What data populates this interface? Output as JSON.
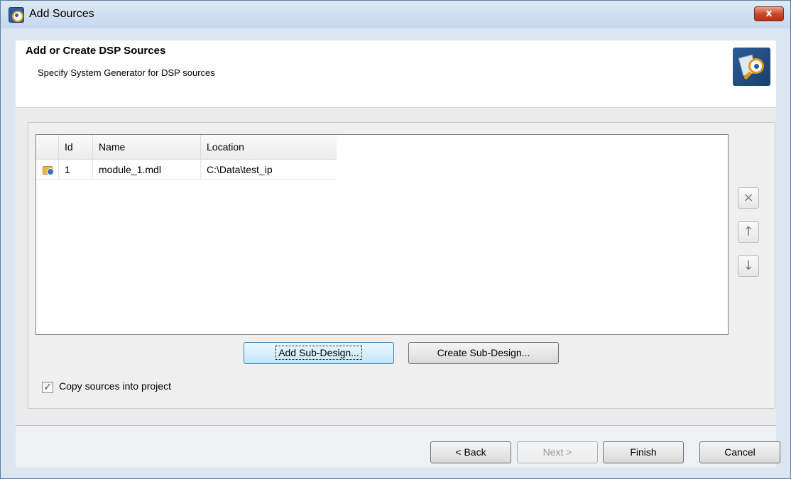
{
  "window": {
    "title": "Add Sources",
    "close_label": "x"
  },
  "header": {
    "title": "Add or Create DSP Sources",
    "subtitle": "Specify System Generator for DSP sources"
  },
  "table": {
    "columns": [
      "Id",
      "Name",
      "Location"
    ],
    "rows": [
      {
        "id": "1",
        "name": "module_1.mdl",
        "location": "C:\\Data\\test_ip"
      }
    ]
  },
  "side_buttons": {
    "remove": "×",
    "up": "↑",
    "down": "↓"
  },
  "actions": {
    "add_sub_design": "Add Sub-Design...",
    "create_sub_design": "Create Sub-Design..."
  },
  "options": {
    "copy_sources_label": "Copy sources into project",
    "copy_sources_checked": true,
    "check_mark": "✓"
  },
  "footer": {
    "back": "< Back",
    "next": "Next >",
    "finish": "Finish",
    "cancel": "Cancel"
  }
}
